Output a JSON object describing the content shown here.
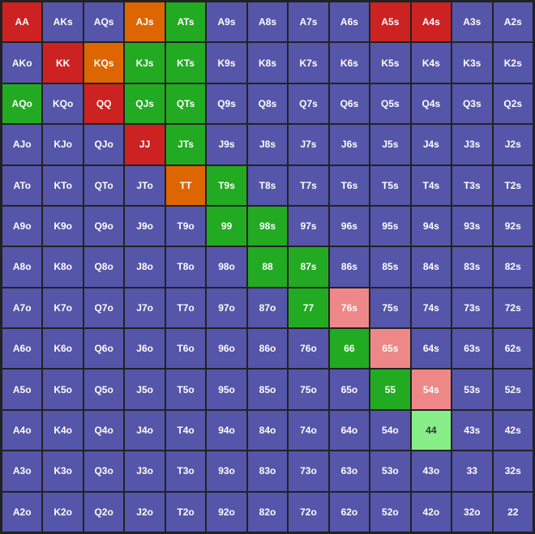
{
  "cells": [
    {
      "label": "AA",
      "color": "red"
    },
    {
      "label": "AKs",
      "color": "purple"
    },
    {
      "label": "AQs",
      "color": "purple"
    },
    {
      "label": "AJs",
      "color": "orange"
    },
    {
      "label": "ATs",
      "color": "green"
    },
    {
      "label": "A9s",
      "color": "purple"
    },
    {
      "label": "A8s",
      "color": "purple"
    },
    {
      "label": "A7s",
      "color": "purple"
    },
    {
      "label": "A6s",
      "color": "purple"
    },
    {
      "label": "A5s",
      "color": "red"
    },
    {
      "label": "A4s",
      "color": "red"
    },
    {
      "label": "A3s",
      "color": "purple"
    },
    {
      "label": "A2s",
      "color": "purple"
    },
    {
      "label": "AKo",
      "color": "purple"
    },
    {
      "label": "KK",
      "color": "red"
    },
    {
      "label": "KQs",
      "color": "orange"
    },
    {
      "label": "KJs",
      "color": "green"
    },
    {
      "label": "KTs",
      "color": "green"
    },
    {
      "label": "K9s",
      "color": "purple"
    },
    {
      "label": "K8s",
      "color": "purple"
    },
    {
      "label": "K7s",
      "color": "purple"
    },
    {
      "label": "K6s",
      "color": "purple"
    },
    {
      "label": "K5s",
      "color": "purple"
    },
    {
      "label": "K4s",
      "color": "purple"
    },
    {
      "label": "K3s",
      "color": "purple"
    },
    {
      "label": "K2s",
      "color": "purple"
    },
    {
      "label": "AQo",
      "color": "green"
    },
    {
      "label": "KQo",
      "color": "purple"
    },
    {
      "label": "QQ",
      "color": "red"
    },
    {
      "label": "QJs",
      "color": "green"
    },
    {
      "label": "QTs",
      "color": "green"
    },
    {
      "label": "Q9s",
      "color": "purple"
    },
    {
      "label": "Q8s",
      "color": "purple"
    },
    {
      "label": "Q7s",
      "color": "purple"
    },
    {
      "label": "Q6s",
      "color": "purple"
    },
    {
      "label": "Q5s",
      "color": "purple"
    },
    {
      "label": "Q4s",
      "color": "purple"
    },
    {
      "label": "Q3s",
      "color": "purple"
    },
    {
      "label": "Q2s",
      "color": "purple"
    },
    {
      "label": "AJo",
      "color": "purple"
    },
    {
      "label": "KJo",
      "color": "purple"
    },
    {
      "label": "QJo",
      "color": "purple"
    },
    {
      "label": "JJ",
      "color": "red"
    },
    {
      "label": "JTs",
      "color": "green"
    },
    {
      "label": "J9s",
      "color": "purple"
    },
    {
      "label": "J8s",
      "color": "purple"
    },
    {
      "label": "J7s",
      "color": "purple"
    },
    {
      "label": "J6s",
      "color": "purple"
    },
    {
      "label": "J5s",
      "color": "purple"
    },
    {
      "label": "J4s",
      "color": "purple"
    },
    {
      "label": "J3s",
      "color": "purple"
    },
    {
      "label": "J2s",
      "color": "purple"
    },
    {
      "label": "ATo",
      "color": "purple"
    },
    {
      "label": "KTo",
      "color": "purple"
    },
    {
      "label": "QTo",
      "color": "purple"
    },
    {
      "label": "JTo",
      "color": "purple"
    },
    {
      "label": "TT",
      "color": "orange"
    },
    {
      "label": "T9s",
      "color": "green"
    },
    {
      "label": "T8s",
      "color": "purple"
    },
    {
      "label": "T7s",
      "color": "purple"
    },
    {
      "label": "T6s",
      "color": "purple"
    },
    {
      "label": "T5s",
      "color": "purple"
    },
    {
      "label": "T4s",
      "color": "purple"
    },
    {
      "label": "T3s",
      "color": "purple"
    },
    {
      "label": "T2s",
      "color": "purple"
    },
    {
      "label": "A9o",
      "color": "purple"
    },
    {
      "label": "K9o",
      "color": "purple"
    },
    {
      "label": "Q9o",
      "color": "purple"
    },
    {
      "label": "J9o",
      "color": "purple"
    },
    {
      "label": "T9o",
      "color": "purple"
    },
    {
      "label": "99",
      "color": "green"
    },
    {
      "label": "98s",
      "color": "green"
    },
    {
      "label": "97s",
      "color": "purple"
    },
    {
      "label": "96s",
      "color": "purple"
    },
    {
      "label": "95s",
      "color": "purple"
    },
    {
      "label": "94s",
      "color": "purple"
    },
    {
      "label": "93s",
      "color": "purple"
    },
    {
      "label": "92s",
      "color": "purple"
    },
    {
      "label": "A8o",
      "color": "purple"
    },
    {
      "label": "K8o",
      "color": "purple"
    },
    {
      "label": "Q8o",
      "color": "purple"
    },
    {
      "label": "J8o",
      "color": "purple"
    },
    {
      "label": "T8o",
      "color": "purple"
    },
    {
      "label": "98o",
      "color": "purple"
    },
    {
      "label": "88",
      "color": "green"
    },
    {
      "label": "87s",
      "color": "green"
    },
    {
      "label": "86s",
      "color": "purple"
    },
    {
      "label": "85s",
      "color": "purple"
    },
    {
      "label": "84s",
      "color": "purple"
    },
    {
      "label": "83s",
      "color": "purple"
    },
    {
      "label": "82s",
      "color": "purple"
    },
    {
      "label": "A7o",
      "color": "purple"
    },
    {
      "label": "K7o",
      "color": "purple"
    },
    {
      "label": "Q7o",
      "color": "purple"
    },
    {
      "label": "J7o",
      "color": "purple"
    },
    {
      "label": "T7o",
      "color": "purple"
    },
    {
      "label": "97o",
      "color": "purple"
    },
    {
      "label": "87o",
      "color": "purple"
    },
    {
      "label": "77",
      "color": "green"
    },
    {
      "label": "76s",
      "color": "pink"
    },
    {
      "label": "75s",
      "color": "purple"
    },
    {
      "label": "74s",
      "color": "purple"
    },
    {
      "label": "73s",
      "color": "purple"
    },
    {
      "label": "72s",
      "color": "purple"
    },
    {
      "label": "A6o",
      "color": "purple"
    },
    {
      "label": "K6o",
      "color": "purple"
    },
    {
      "label": "Q6o",
      "color": "purple"
    },
    {
      "label": "J6o",
      "color": "purple"
    },
    {
      "label": "T6o",
      "color": "purple"
    },
    {
      "label": "96o",
      "color": "purple"
    },
    {
      "label": "86o",
      "color": "purple"
    },
    {
      "label": "76o",
      "color": "purple"
    },
    {
      "label": "66",
      "color": "green"
    },
    {
      "label": "65s",
      "color": "pink"
    },
    {
      "label": "64s",
      "color": "purple"
    },
    {
      "label": "63s",
      "color": "purple"
    },
    {
      "label": "62s",
      "color": "purple"
    },
    {
      "label": "A5o",
      "color": "purple"
    },
    {
      "label": "K5o",
      "color": "purple"
    },
    {
      "label": "Q5o",
      "color": "purple"
    },
    {
      "label": "J5o",
      "color": "purple"
    },
    {
      "label": "T5o",
      "color": "purple"
    },
    {
      "label": "95o",
      "color": "purple"
    },
    {
      "label": "85o",
      "color": "purple"
    },
    {
      "label": "75o",
      "color": "purple"
    },
    {
      "label": "65o",
      "color": "purple"
    },
    {
      "label": "55",
      "color": "green"
    },
    {
      "label": "54s",
      "color": "pink"
    },
    {
      "label": "53s",
      "color": "purple"
    },
    {
      "label": "52s",
      "color": "purple"
    },
    {
      "label": "A4o",
      "color": "purple"
    },
    {
      "label": "K4o",
      "color": "purple"
    },
    {
      "label": "Q4o",
      "color": "purple"
    },
    {
      "label": "J4o",
      "color": "purple"
    },
    {
      "label": "T4o",
      "color": "purple"
    },
    {
      "label": "94o",
      "color": "purple"
    },
    {
      "label": "84o",
      "color": "purple"
    },
    {
      "label": "74o",
      "color": "purple"
    },
    {
      "label": "64o",
      "color": "purple"
    },
    {
      "label": "54o",
      "color": "purple"
    },
    {
      "label": "44",
      "color": "ltgreen"
    },
    {
      "label": "43s",
      "color": "purple"
    },
    {
      "label": "42s",
      "color": "purple"
    },
    {
      "label": "A3o",
      "color": "purple"
    },
    {
      "label": "K3o",
      "color": "purple"
    },
    {
      "label": "Q3o",
      "color": "purple"
    },
    {
      "label": "J3o",
      "color": "purple"
    },
    {
      "label": "T3o",
      "color": "purple"
    },
    {
      "label": "93o",
      "color": "purple"
    },
    {
      "label": "83o",
      "color": "purple"
    },
    {
      "label": "73o",
      "color": "purple"
    },
    {
      "label": "63o",
      "color": "purple"
    },
    {
      "label": "53o",
      "color": "purple"
    },
    {
      "label": "43o",
      "color": "purple"
    },
    {
      "label": "33",
      "color": "purple"
    },
    {
      "label": "32s",
      "color": "purple"
    },
    {
      "label": "A2o",
      "color": "purple"
    },
    {
      "label": "K2o",
      "color": "purple"
    },
    {
      "label": "Q2o",
      "color": "purple"
    },
    {
      "label": "J2o",
      "color": "purple"
    },
    {
      "label": "T2o",
      "color": "purple"
    },
    {
      "label": "92o",
      "color": "purple"
    },
    {
      "label": "82o",
      "color": "purple"
    },
    {
      "label": "72o",
      "color": "purple"
    },
    {
      "label": "62o",
      "color": "purple"
    },
    {
      "label": "52o",
      "color": "purple"
    },
    {
      "label": "42o",
      "color": "purple"
    },
    {
      "label": "32o",
      "color": "purple"
    },
    {
      "label": "22",
      "color": "purple"
    }
  ]
}
